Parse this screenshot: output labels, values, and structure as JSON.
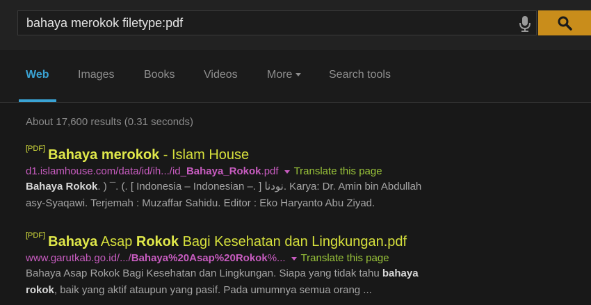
{
  "search": {
    "query": "bahaya merokok filetype:pdf",
    "mic_icon": "microphone-icon",
    "search_icon": "search-icon",
    "accent_color": "#c98d1b"
  },
  "tabs": [
    {
      "label": "Web"
    },
    {
      "label": "Images"
    },
    {
      "label": "Books"
    },
    {
      "label": "Videos"
    },
    {
      "label": "More"
    },
    {
      "label": "Search tools"
    }
  ],
  "stats": "About 17,600 results (0.31 seconds)",
  "results": [
    {
      "tag": "[PDF]",
      "title_bold": "Bahaya merokok",
      "title_rest": " - Islam House",
      "url_pre": "d1.islamhouse.com/data/id/ih.../id_",
      "url_bold": "Bahaya_Rokok",
      "url_post": ".pdf",
      "translate": "Translate this page",
      "snippet_bold": "Bahaya Rokok",
      "snippet_1_rest": ". ) ¯. (. [ Indonesia – Indonesian –. ] نودنا. Karya: Dr. Amin bin Abdullah",
      "snippet_2": "asy-Syaqawi. Terjemah : Muzaffar Sahidu. Editor : Eko Haryanto Abu Ziyad."
    },
    {
      "tag": "[PDF]",
      "title_bold_1": "Bahaya",
      "title_mid_1": " Asap ",
      "title_bold_2": "Rokok",
      "title_rest": " Bagi Kesehatan dan Lingkungan.pdf",
      "url_pre": "www.garutkab.go.id/.../",
      "url_bold": "Bahaya%20Asap%20Rokok",
      "url_post": "%...",
      "translate": "Translate this page",
      "snippet_1_pre": "Bahaya Asap Rokok Bagi Kesehatan dan Lingkungan. Siapa yang tidak tahu ",
      "snippet_1_bold": "bahaya",
      "snippet_2_bold": "rokok",
      "snippet_2_rest": ", baik yang aktif ataupun yang pasif. Pada umumnya semua orang ..."
    }
  ]
}
